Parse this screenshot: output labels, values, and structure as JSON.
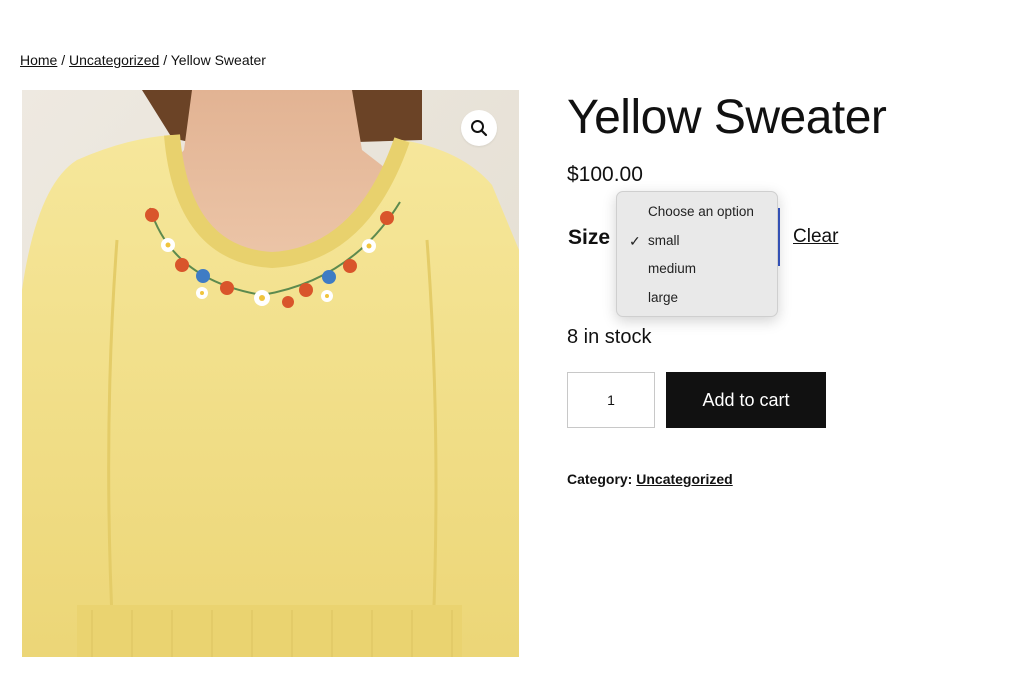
{
  "breadcrumb": {
    "home": "Home",
    "sep1": "/",
    "category": "Uncategorized",
    "sep2": "/",
    "current": "Yellow Sweater"
  },
  "product": {
    "title": "Yellow Sweater",
    "price": "$100.00",
    "stock": "8 in stock",
    "quantity": "1",
    "add_to_cart": "Add to cart",
    "category_label": "Category:",
    "category": "Uncategorized"
  },
  "variation": {
    "label": "Size",
    "clear": "Clear",
    "selected": "small",
    "options": [
      "Choose an option",
      "small",
      "medium",
      "large"
    ]
  },
  "icons": {
    "zoom": "magnifier-icon",
    "check": "checkmark-icon"
  },
  "colors": {
    "sweater": "#f2e08a",
    "button": "#111111",
    "focus": "#3858c4"
  }
}
